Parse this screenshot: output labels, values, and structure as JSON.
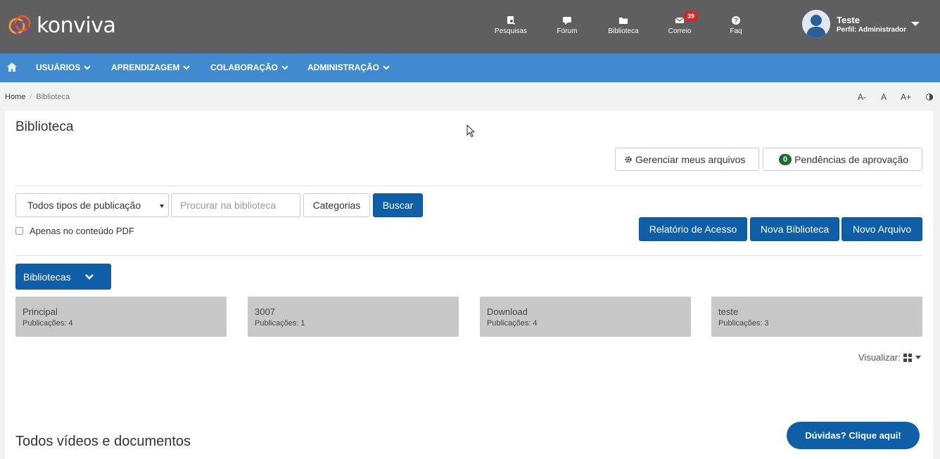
{
  "brand": {
    "name": "konviva"
  },
  "top_nav": [
    {
      "label": "Pesquisas",
      "icon": "search-survey-icon"
    },
    {
      "label": "Fórum",
      "icon": "comment-icon"
    },
    {
      "label": "Biblioteca",
      "icon": "folder-icon"
    },
    {
      "label": "Correio",
      "icon": "envelope-icon",
      "badge": "39"
    },
    {
      "label": "Faq",
      "icon": "question-circle-icon"
    }
  ],
  "user": {
    "name": "Teste",
    "role": "Perfil: Administrador"
  },
  "menu": [
    {
      "label": "USUÁRIOS"
    },
    {
      "label": "APRENDIZAGEM"
    },
    {
      "label": "COLABORAÇÃO"
    },
    {
      "label": "ADMINISTRAÇÃO"
    }
  ],
  "breadcrumb": {
    "home": "Home",
    "separator": "/",
    "current": "Biblioteca"
  },
  "font_controls": {
    "decrease": "A-",
    "normal": "A",
    "increase": "A+"
  },
  "page": {
    "title": "Biblioteca",
    "manage_files_label": "Gerenciar meus arquivos",
    "pending_count": "0",
    "pending_label": "Pendências de aprovação"
  },
  "search": {
    "type_select_value": "Todos tipos de publicação",
    "placeholder": "Procurar na biblioteca",
    "categories_label": "Categorias",
    "search_label": "Buscar",
    "pdf_only_label": "Apenas no conteúdo PDF"
  },
  "actions": {
    "access_report": "Relatório de Acesso",
    "new_library": "Nova Biblioteca",
    "new_file": "Novo Arquivo"
  },
  "libraries": {
    "dropdown_label": "Bibliotecas",
    "items": [
      {
        "name": "Principal",
        "count_label": "Publicações: 4"
      },
      {
        "name": "3007",
        "count_label": "Publicações: 1"
      },
      {
        "name": "Download",
        "count_label": "Publicações: 4"
      },
      {
        "name": "teste",
        "count_label": "Publicações: 3"
      }
    ]
  },
  "view": {
    "label": "Visualizar:"
  },
  "section": {
    "title": "Todos vídeos e documentos"
  },
  "help": {
    "label": "Dúvidas? Clique aqui!"
  },
  "colors": {
    "header": "#5f5f5f",
    "menu": "#418ad0",
    "primary": "#0f5ea8",
    "badge": "#e02020",
    "pending_badge": "#1c6b2a"
  }
}
